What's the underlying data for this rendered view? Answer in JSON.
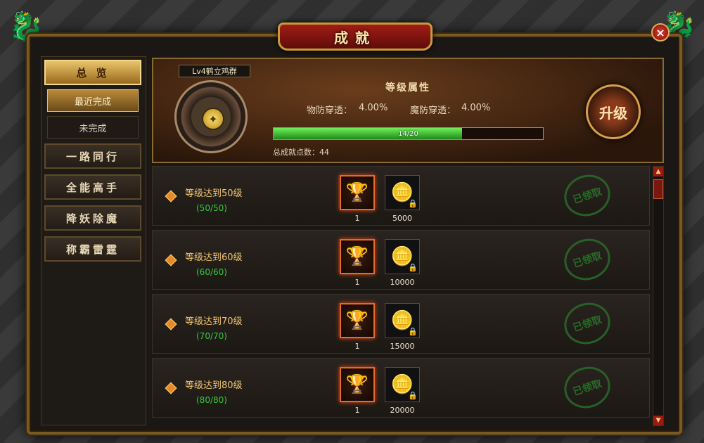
{
  "window": {
    "title": "成就",
    "close_label": "×"
  },
  "sidebar": {
    "overview": "总 览",
    "sub_items": [
      {
        "label": "最近完成",
        "active": true
      },
      {
        "label": "未完成",
        "active": false
      }
    ],
    "categories": [
      "一路同行",
      "全能高手",
      "降妖除魔",
      "称霸雷霆"
    ]
  },
  "header": {
    "level_tag": "Lv4鹤立鸡群",
    "attr_title": "等级属性",
    "phys_pen_label": "物防穿透：",
    "phys_pen_value": "4.00%",
    "magic_pen_label": "魔防穿透：",
    "magic_pen_value": "4.00%",
    "progress_text": "14/20",
    "progress_fraction": 0.7,
    "total_points_label": "总成就点数：",
    "total_points_value": "44",
    "upgrade_label": "升级"
  },
  "achievements": [
    {
      "title": "等级达到50级",
      "progress": "(50/50)",
      "trophy_qty": "1",
      "coin_qty": "5000",
      "status": "已领取"
    },
    {
      "title": "等级达到60级",
      "progress": "(60/60)",
      "trophy_qty": "1",
      "coin_qty": "10000",
      "status": "已领取"
    },
    {
      "title": "等级达到70级",
      "progress": "(70/70)",
      "trophy_qty": "1",
      "coin_qty": "15000",
      "status": "已领取"
    },
    {
      "title": "等级达到80级",
      "progress": "(80/80)",
      "trophy_qty": "1",
      "coin_qty": "20000",
      "status": "已领取"
    }
  ],
  "colors": {
    "accent_gold": "#e9c36a",
    "frame_red": "#a21c16",
    "progress_green": "#2ed03a",
    "stamp_green": "#2a7a2a"
  }
}
